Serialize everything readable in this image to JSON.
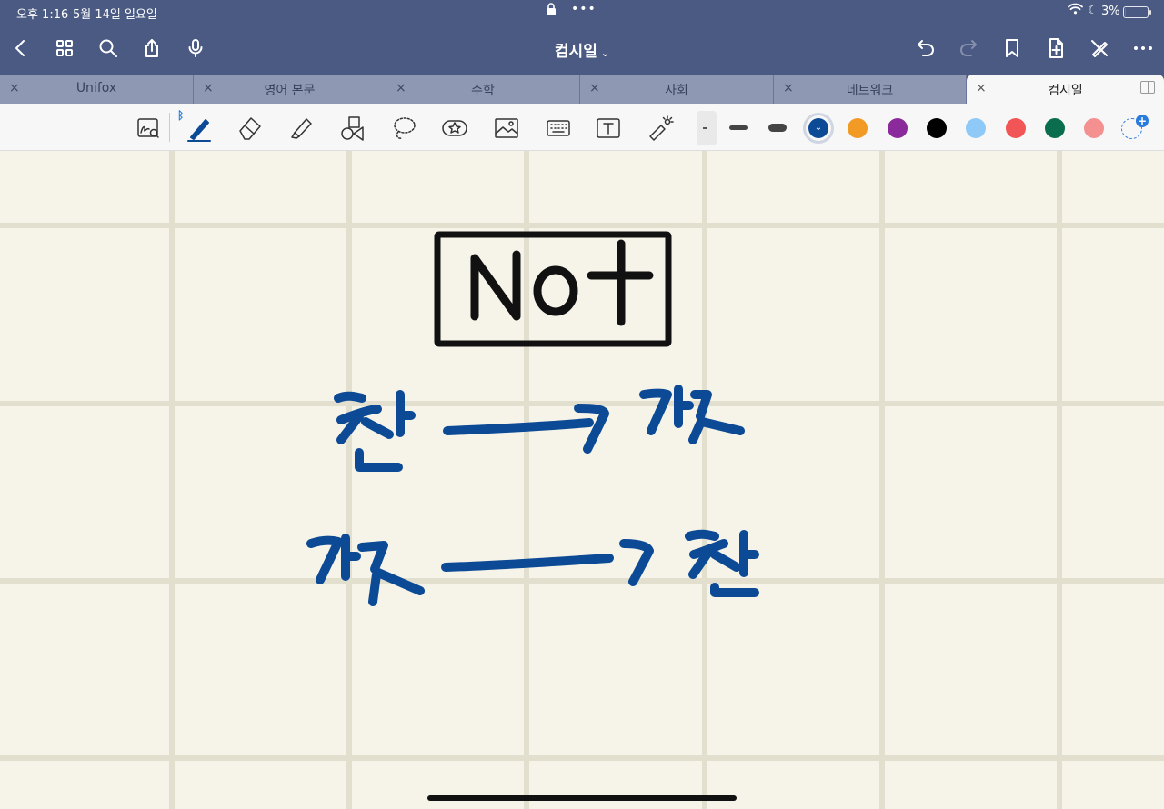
{
  "status_bar": {
    "time": "오후 1:16",
    "date": "5월 14일 일요일",
    "battery_percent": "3%",
    "battery_level": 0.03,
    "lock_icon": "lock-icon",
    "wifi_icon": "wifi-icon",
    "moon_icon": "moon-icon"
  },
  "nav": {
    "title": "컴시일",
    "title_chevron": "⌄",
    "left_icons": [
      "back-icon",
      "grid-icon",
      "search-icon",
      "share-icon",
      "microphone-icon"
    ],
    "right_icons": [
      "undo-icon",
      "redo-icon",
      "bookmark-icon",
      "add-page-icon",
      "no-pen-icon",
      "more-icon"
    ]
  },
  "tabs": [
    {
      "label": "Unifox",
      "close": "×"
    },
    {
      "label": "영어 본문",
      "close": "×"
    },
    {
      "label": "수학",
      "close": "×"
    },
    {
      "label": "사회",
      "close": "×"
    },
    {
      "label": "네트워크",
      "close": "×"
    },
    {
      "label": "컴시일",
      "close": "×",
      "active": true
    }
  ],
  "toolbar": {
    "bluetooth_glyph": "ᛒ",
    "tools": [
      "zoom-writing-icon",
      "pen-icon",
      "eraser-icon",
      "highlighter-icon",
      "shapes-icon",
      "lasso-icon",
      "sticker-icon",
      "image-icon",
      "keyboard-icon",
      "text-box-icon",
      "laser-pointer-icon"
    ],
    "colors": [
      "#0c4a96",
      "#f29a26",
      "#8b2a9a",
      "#000000",
      "#8ec9f8",
      "#f25555",
      "#0a6e4e",
      "#f59090"
    ],
    "selected_color_index": 0,
    "selected_chevron": "⌄",
    "add_color": "+"
  },
  "canvas": {
    "background": "#f6f4e9",
    "handwriting": [
      {
        "text": "Not",
        "color": "#111111"
      },
      {
        "text": "참 ──> 거짓",
        "color": "#0c4a96"
      },
      {
        "text": "거짓 ──> 참",
        "color": "#0c4a96"
      }
    ]
  }
}
